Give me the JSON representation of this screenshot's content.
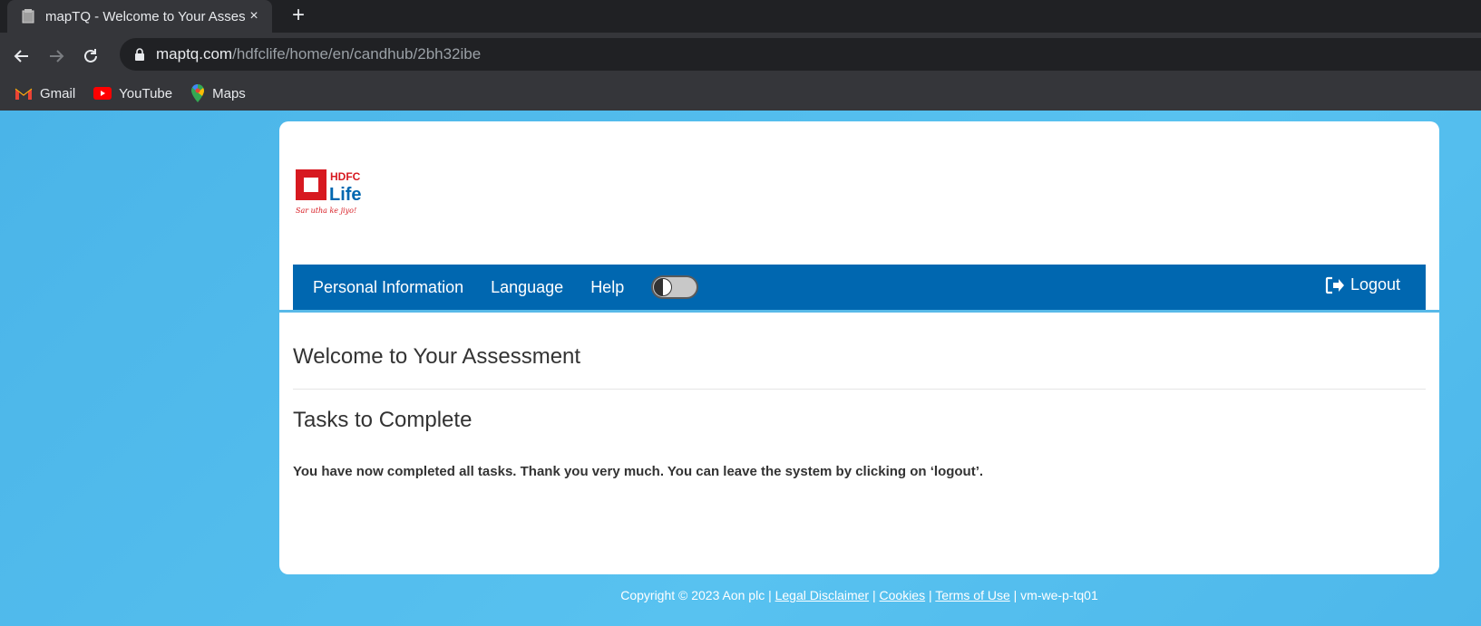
{
  "browser": {
    "tab_title": "mapTQ - Welcome to Your Assess",
    "tab_close": "×",
    "new_tab": "+",
    "url_host": "maptq.com",
    "url_path": "/hdfclife/home/en/candhub/2bh32ibe",
    "bookmarks": [
      {
        "label": "Gmail",
        "icon": "gmail-icon"
      },
      {
        "label": "YouTube",
        "icon": "youtube-icon"
      },
      {
        "label": "Maps",
        "icon": "maps-icon"
      }
    ]
  },
  "brand": {
    "logo_line1": "HDFC",
    "logo_line2": "Life",
    "tagline": "Sar utha ke jiyo!",
    "red": "#d71920",
    "blue": "#0067b0"
  },
  "nav": {
    "items": [
      "Personal Information",
      "Language",
      "Help"
    ],
    "logout": "Logout"
  },
  "main": {
    "welcome_heading": "Welcome to Your Assessment",
    "tasks_heading": "Tasks to Complete",
    "message": "You have now completed all tasks. Thank you very much. You can leave the system by clicking on ‘logout’."
  },
  "footer": {
    "copyright": "Copyright © 2023 Aon plc | ",
    "links": [
      "Legal Disclaimer",
      "Cookies",
      "Terms of Use"
    ],
    "server": "vm-we-p-tq01"
  }
}
